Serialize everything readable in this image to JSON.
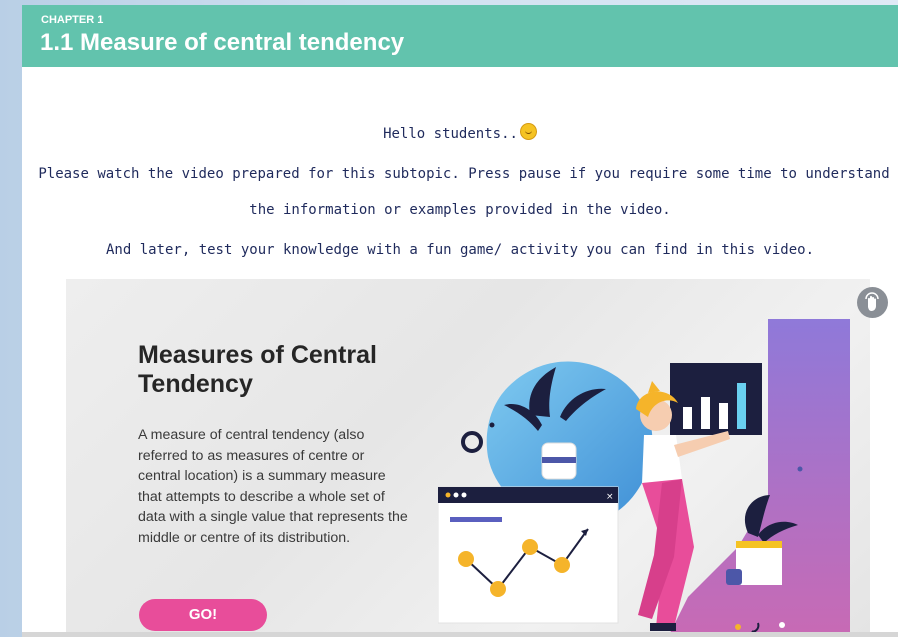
{
  "header": {
    "chapter": "CHAPTER 1",
    "title": "1.1 Measure of central tendency",
    "color": "#62c3ad"
  },
  "content": {
    "greeting": "Hello students..",
    "instructions_line1": "Please watch the video prepared for this subtopic. Press pause if you require some time to understand",
    "instructions_line2": "the information or examples provided in the video.",
    "activity_text": "And later, test your knowledge with a fun game/ activity you can find in this video."
  },
  "video": {
    "title": "Measures of Central Tendency",
    "description": "A measure of central tendency (also referred to as measures of centre or central location) is a summary measure that attempts to describe a whole set of data with a single value that represents the middle or centre of its distribution.",
    "go_label": "GO!",
    "accent": "#e84d9a"
  },
  "icons": [
    "smiley-emoji-icon",
    "touch-hand-icon",
    "illustration-woman-charts"
  ]
}
